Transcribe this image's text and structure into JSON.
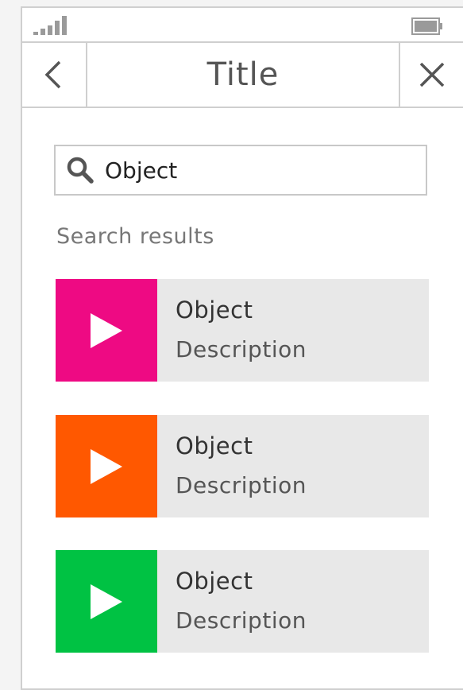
{
  "header": {
    "title": "Title"
  },
  "search": {
    "value": "Object"
  },
  "results": {
    "label": "Search results",
    "items": [
      {
        "title": "Object",
        "description": "Description",
        "color": "#ee0a83"
      },
      {
        "title": "Object",
        "description": "Description",
        "color": "#ff5800"
      },
      {
        "title": "Object",
        "description": "Description",
        "color": "#00c243"
      }
    ]
  },
  "icons": {
    "signal": "signal-icon",
    "battery": "battery-icon",
    "back": "chevron-left-icon",
    "close": "close-icon",
    "search": "search-icon",
    "play": "play-icon"
  },
  "colors": {
    "border": "#cfcfcf",
    "item_background": "#e8e8e8"
  }
}
